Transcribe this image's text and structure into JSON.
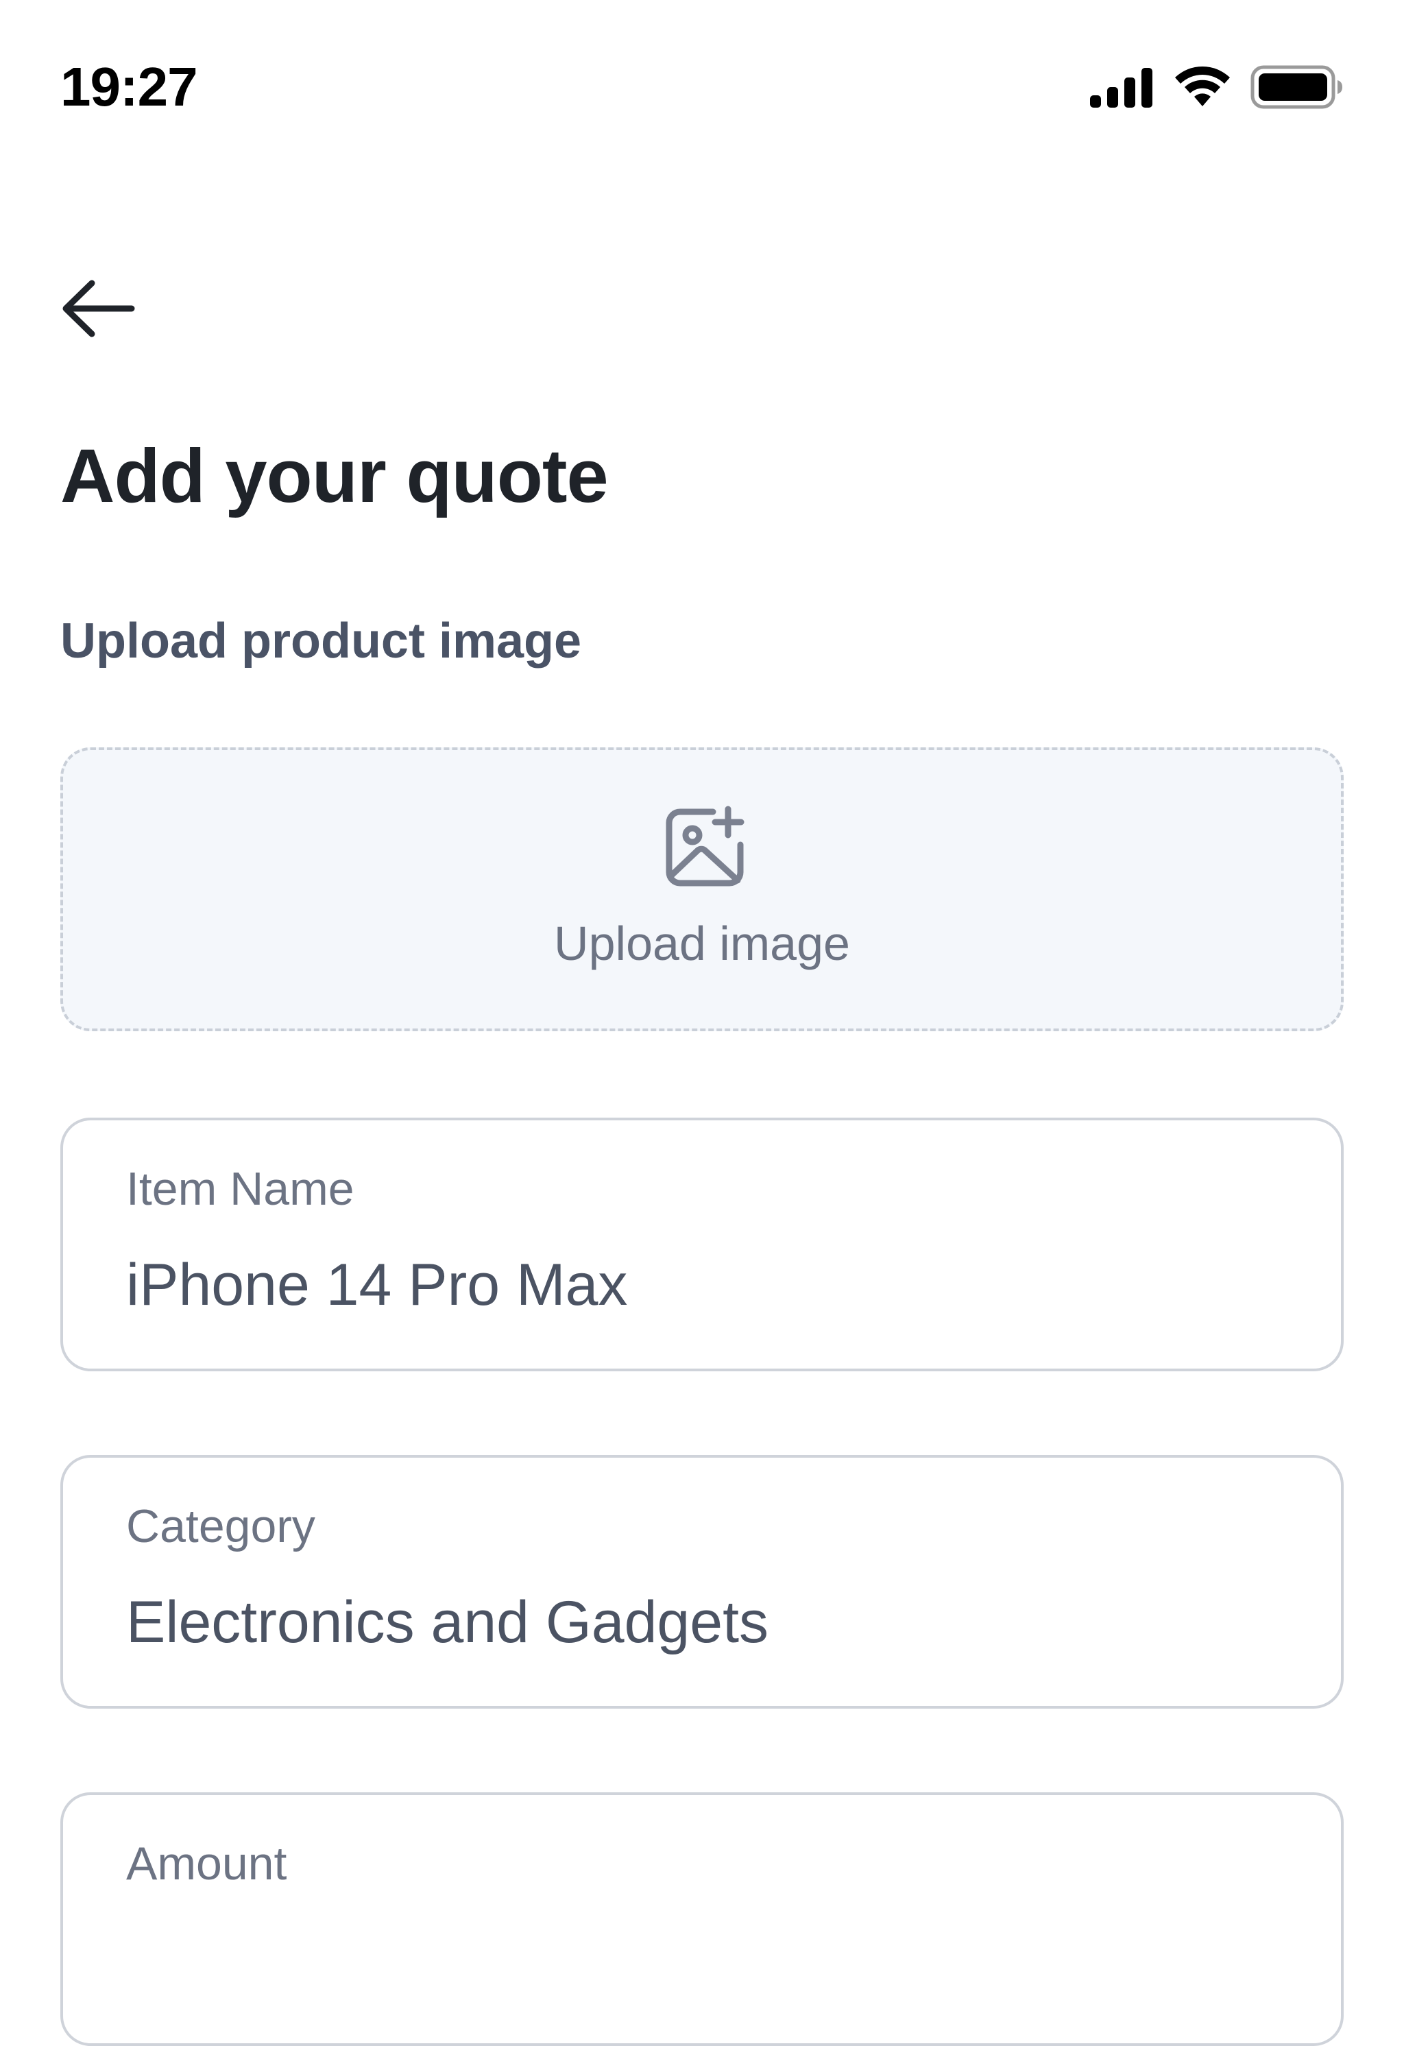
{
  "status_bar": {
    "time": "19:27",
    "icons": [
      "signal-icon",
      "wifi-icon",
      "battery-icon"
    ]
  },
  "header": {
    "back_icon": "arrow-left-icon"
  },
  "page": {
    "title": "Add your quote"
  },
  "upload": {
    "section_label": "Upload product image",
    "icon": "image-plus-icon",
    "button_label": "Upload image"
  },
  "fields": {
    "item_name": {
      "label": "Item Name",
      "value": "iPhone 14 Pro Max"
    },
    "category": {
      "label": "Category",
      "value": "Electronics and Gadgets"
    },
    "amount": {
      "label": "Amount"
    }
  },
  "colors": {
    "title": "#1f2329",
    "secondary_text": "#4a5366",
    "muted_text": "#6c7383",
    "field_border": "#cfd3da",
    "upload_bg": "#f4f7fb",
    "upload_border": "#c9cfd8"
  }
}
